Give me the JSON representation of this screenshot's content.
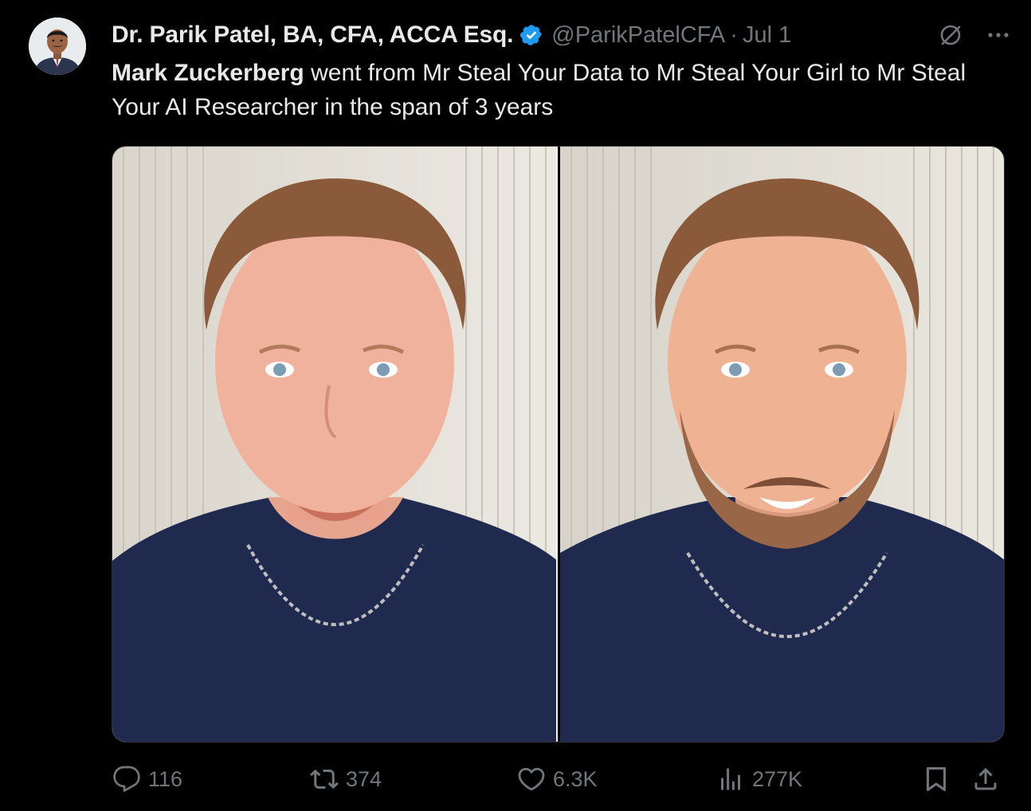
{
  "tweet": {
    "author": {
      "display_name": "Dr. Parik Patel, BA, CFA, ACCA Esq.",
      "handle": "@ParikPatelCFA",
      "verified": true,
      "avatar_icon": "profile-photo"
    },
    "separator": "·",
    "date": "Jul 1",
    "text": {
      "mention": "Mark Zuckerberg",
      "body": " went from Mr Steal Your Data to Mr Steal Your Girl to Mr Steal Your AI Researcher in the span of 3 years"
    },
    "media": {
      "count": 2,
      "images": [
        "photo-left",
        "photo-right"
      ]
    },
    "stats": {
      "replies": "116",
      "reposts": "374",
      "likes": "6.3K",
      "views": "277K"
    }
  },
  "icons": {
    "verified": "verified-badge-icon",
    "grok": "grok-icon",
    "more": "more-icon",
    "reply": "reply-icon",
    "repost": "repost-icon",
    "like": "like-icon",
    "views": "views-icon",
    "bookmark": "bookmark-icon",
    "share": "share-icon"
  },
  "colors": {
    "background": "#000000",
    "text_primary": "#e7e9ea",
    "text_secondary": "#71767b",
    "verified_blue": "#1d9bf0",
    "shirt_navy": "#1f2a4e"
  }
}
